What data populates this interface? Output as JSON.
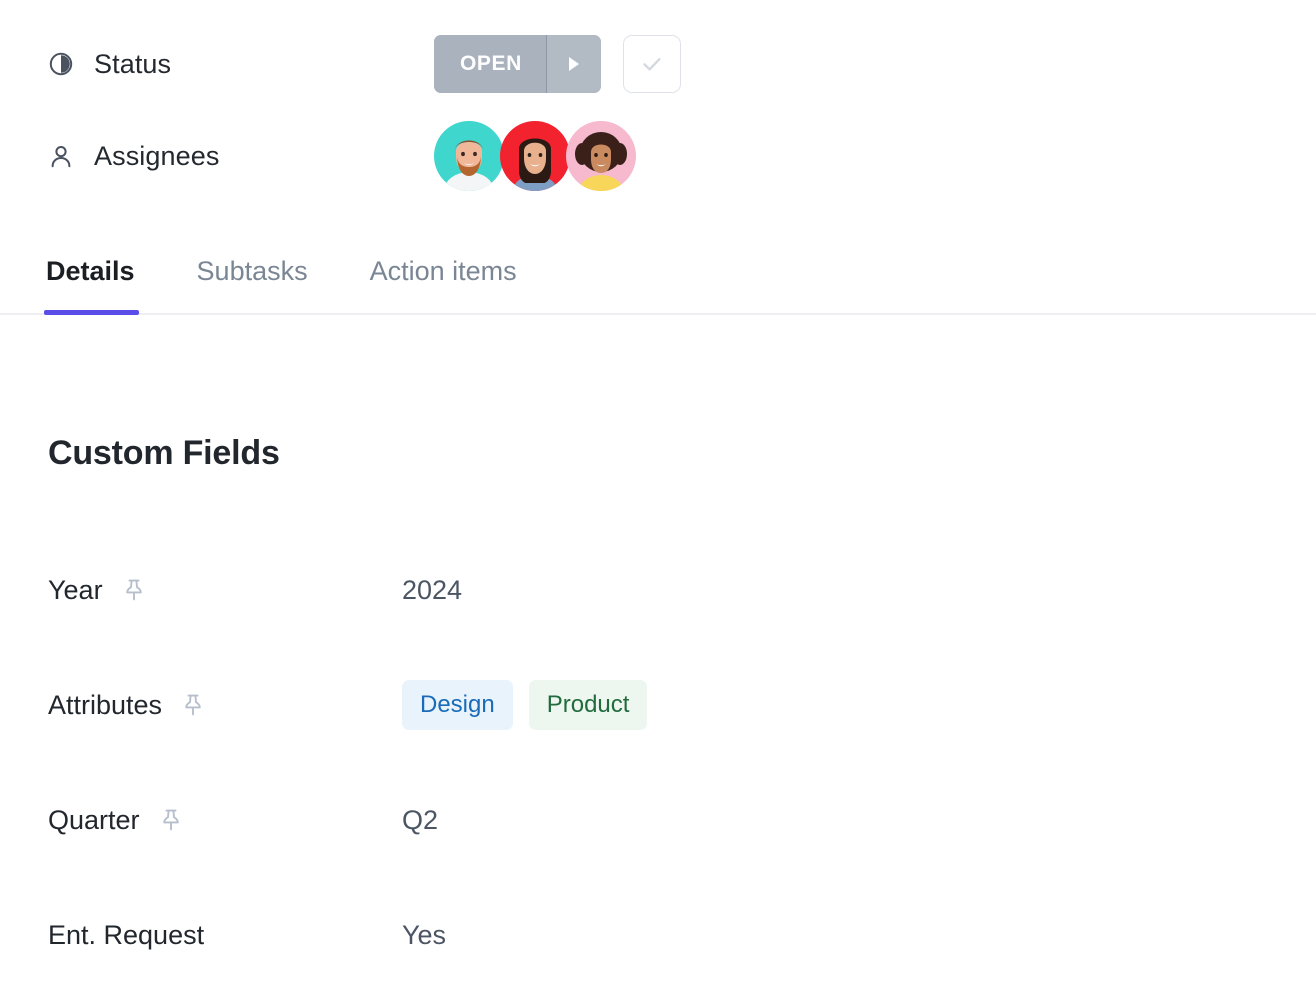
{
  "meta": {
    "rows": [
      {
        "label": "Status",
        "icon": "half-filled-circle-icon"
      },
      {
        "label": "Assignees",
        "icon": "person-icon"
      }
    ]
  },
  "status": {
    "value": "OPEN",
    "caret_icon": "caret-right-icon",
    "check_icon": "check-icon",
    "pill_color": "#aab2bd",
    "pill_text_color": "#ffffff"
  },
  "assignees": [
    {
      "name": "avatar-1",
      "background": "#3ed6cd",
      "hair": "#7a4a2a",
      "skin": "#f0b799",
      "clothing": "#ffffff"
    },
    {
      "name": "avatar-2",
      "background": "#f2222f",
      "hair": "#2b1a14",
      "skin": "#e8b08d",
      "clothing": "#7f9ec4"
    },
    {
      "name": "avatar-3",
      "background": "#f7b9cd",
      "hair": "#3a2019",
      "skin": "#c88a5e",
      "clothing": "#f7d65a"
    }
  ],
  "tabs": [
    {
      "label": "Details",
      "active": true
    },
    {
      "label": "Subtasks",
      "active": false
    },
    {
      "label": "Action items",
      "active": false
    }
  ],
  "section": {
    "title": "Custom Fields"
  },
  "fields": [
    {
      "label": "Year",
      "pinned": true,
      "value": "2024",
      "type": "text"
    },
    {
      "label": "Attributes",
      "pinned": true,
      "type": "chips",
      "chips": [
        {
          "label": "Design",
          "bg": "#e9f3fc",
          "fg": "#1a6bb8"
        },
        {
          "label": "Product",
          "bg": "#edf6ef",
          "fg": "#216b3d"
        }
      ]
    },
    {
      "label": "Quarter",
      "pinned": true,
      "value": "Q2",
      "type": "text"
    },
    {
      "label": "Ent. Request",
      "pinned": false,
      "value": "Yes",
      "type": "text"
    }
  ],
  "colors": {
    "accent": "#5b4ee8",
    "label_text": "#22272e",
    "value_text": "#4b5563",
    "muted_text": "#7a8694",
    "divider": "#edeff2",
    "pin": "#b6bfcb"
  }
}
